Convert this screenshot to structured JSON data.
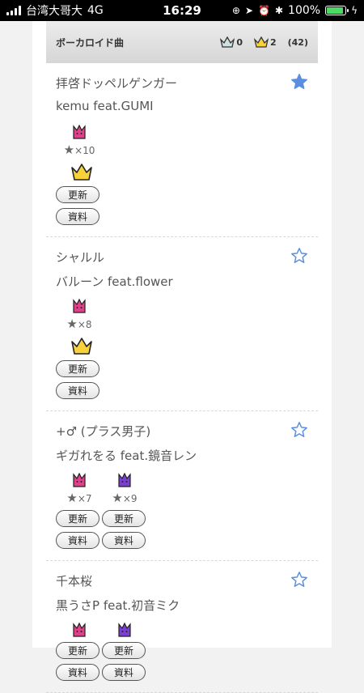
{
  "status": {
    "carrier": "台湾大哥大",
    "network": "4G",
    "time": "16:29",
    "battery": "100%"
  },
  "header": {
    "title": "ボーカロイド曲",
    "silver_count": "0",
    "gold_count": "2",
    "total": "(42)"
  },
  "songs": [
    {
      "title": "拝啓ドッペルゲンガー",
      "artist": "kemu feat.GUMI",
      "favorited": true,
      "difficulties": [
        {
          "color": "pink",
          "stars": "×10"
        }
      ],
      "crown": true,
      "update_label": "更新",
      "info_label": "資料"
    },
    {
      "title": "シャルル",
      "artist": "バルーン feat.flower",
      "favorited": false,
      "difficulties": [
        {
          "color": "pink",
          "stars": "×8"
        }
      ],
      "crown": true,
      "update_label": "更新",
      "info_label": "資料"
    },
    {
      "title": "+♂ (プラス男子)",
      "artist": "ギガれをる feat.鏡音レン",
      "favorited": false,
      "difficulties": [
        {
          "color": "pink",
          "stars": "×7"
        },
        {
          "color": "purple",
          "stars": "×9"
        }
      ],
      "crown": false,
      "update_label": "更新",
      "info_label": "資料"
    },
    {
      "title": "千本桜",
      "artist": "黒うさP feat.初音ミク",
      "favorited": false,
      "difficulties": [
        {
          "color": "pink",
          "stars": ""
        },
        {
          "color": "purple",
          "stars": ""
        }
      ],
      "crown": false,
      "update_label": "更新",
      "info_label": "資料"
    }
  ],
  "colors": {
    "pink": "#e0408a",
    "purple": "#7a3fd0",
    "star": "#5a8fe0",
    "gold": "#f7d23a"
  }
}
